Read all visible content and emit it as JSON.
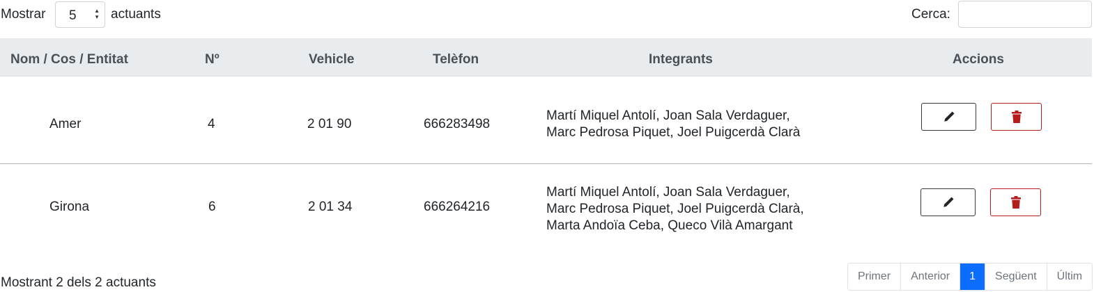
{
  "length_control": {
    "before": "Mostrar",
    "value": "5",
    "after": "actuants"
  },
  "search": {
    "label": "Cerca:",
    "value": ""
  },
  "table": {
    "headers": [
      "Nom / Cos / Entitat",
      "Nº",
      "Vehicle",
      "Telèfon",
      "Integrants",
      "Accions"
    ],
    "rows": [
      {
        "name": "Amer",
        "number": "4",
        "vehicle": "2 01 90",
        "phone": "666283498",
        "members": [
          "Martí Miquel Antolí, Joan Sala Verdaguer,",
          "Marc Pedrosa Piquet, Joel Puigcerdà Clarà"
        ]
      },
      {
        "name": "Girona",
        "number": "6",
        "vehicle": "2 01 34",
        "phone": "666264216",
        "members": [
          "Martí Miquel Antolí, Joan Sala Verdaguer,",
          "Marc Pedrosa Piquet, Joel Puigcerdà Clarà,",
          "Marta Andoïa Ceba, Queco Vilà Amargant"
        ]
      }
    ]
  },
  "info": "Mostrant 2 dels 2 actuants",
  "pagination": {
    "first": "Primer",
    "previous": "Anterior",
    "current": "1",
    "next": "Següent",
    "last": "Últim"
  },
  "colors": {
    "header_bg": "#e9ecef",
    "delete": "#b51d1d",
    "active_page": "#0d6efd"
  },
  "icons": {
    "edit": "pencil-icon",
    "delete": "trash-icon"
  }
}
